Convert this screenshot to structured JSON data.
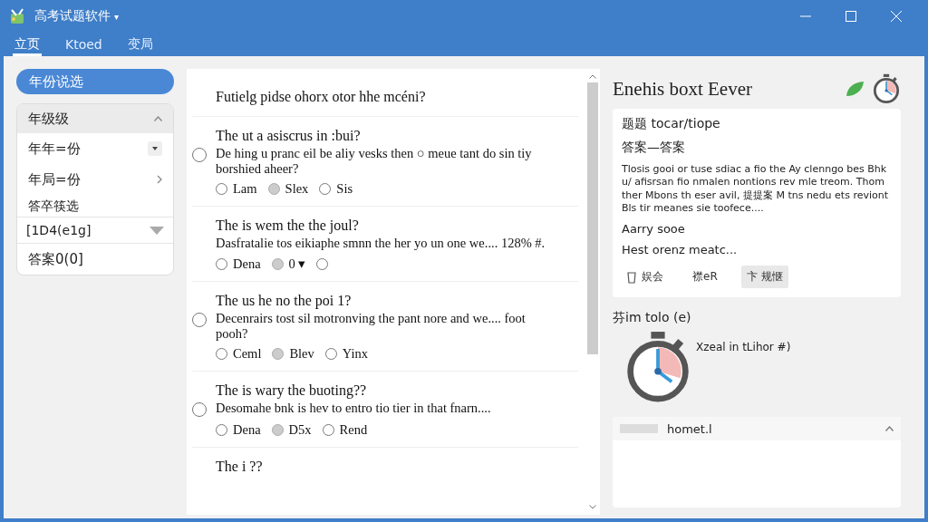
{
  "window": {
    "title": "高考试题软件",
    "title_caret": "▾"
  },
  "tabs": [
    {
      "label": "立页",
      "selected": true
    },
    {
      "label": "Ktoed",
      "selected": false
    },
    {
      "label": "变局",
      "selected": false
    }
  ],
  "sidebar": {
    "filter_button": {
      "label": "年份说选",
      "selected": true
    },
    "group": {
      "title": "年级级",
      "expanded": true,
      "items": [
        {
          "label": "年年=份",
          "kind": "dropdown"
        },
        {
          "label": "年局=份",
          "kind": "arrow"
        }
      ]
    },
    "answer_label": "答卒筷选",
    "answer_select": "[1D4(e1g]",
    "answer_count": "答案0(0]"
  },
  "questions": [
    {
      "title": "Futielg pidse ohorx otor hhe mcéni?"
    },
    {
      "title": "The ut a asiscrus in :bui?",
      "body": "De hing u pranc eil be aliy vesks then ○ meue tant do sin tiy borshied aheer?",
      "side_radio": {
        "selected": false
      },
      "options": [
        {
          "label": "Lam",
          "selected": false
        },
        {
          "label": "Slex",
          "selected": true
        },
        {
          "label": "Sis",
          "selected": false
        }
      ]
    },
    {
      "title": "The is wem the the joul?",
      "body": "Dasfratalie tos eikiaphe smnn the her yo un one we.... 128% #.",
      "options": [
        {
          "label": "Dena",
          "selected": false
        },
        {
          "label": "0 ▾",
          "selected": true
        },
        {
          "selected": false
        }
      ]
    },
    {
      "title": "The us he no the poi 1?",
      "body": "Decenrairs tost sil motronving the pant nore and we.... foot pooh?",
      "side_radio": {
        "selected": false
      },
      "options": [
        {
          "label": "Ceml",
          "selected": false
        },
        {
          "label": "Blev",
          "selected": true
        },
        {
          "label": "Yinx",
          "selected": false
        }
      ]
    },
    {
      "title": "The is wary the buoting??",
      "body": "Desomahe bnk is hev to entro tio tier in that fnarn....",
      "side_radio": {
        "selected": false
      },
      "options": [
        {
          "label": "Dena",
          "selected": false
        },
        {
          "label": "D5x",
          "selected": true
        },
        {
          "label": "Rend",
          "selected": false
        }
      ]
    },
    {
      "title": "The i ??"
    }
  ],
  "detail": {
    "title": "Enehis boxt Eever",
    "card": {
      "heading": "题题 tocar/tiope",
      "answer": "答案—答案",
      "text": "Tlosis gooi or tuse sdiac a fio the Ay clenngo bes Bhk u/ afisrsan fio nmalen nontions rev mle treom. Thom ther Mbons th eser avil, 提提案 M tns nedu ets reviont Bls tir meanes sie toofece....",
      "line_1": "Aarry sooe",
      "line_2": "Hest orenz meatc...",
      "actions": [
        {
          "label": "娱会",
          "kind": "trash"
        },
        {
          "label": "襟eR",
          "kind": "plain"
        },
        {
          "label": "卞 规惬",
          "kind": "filled"
        }
      ]
    },
    "timer": {
      "title": "芬im tolo (e)",
      "note": "Xzeal in tLihor #)"
    },
    "panel": {
      "title": "homet.l",
      "expanded": true
    }
  }
}
